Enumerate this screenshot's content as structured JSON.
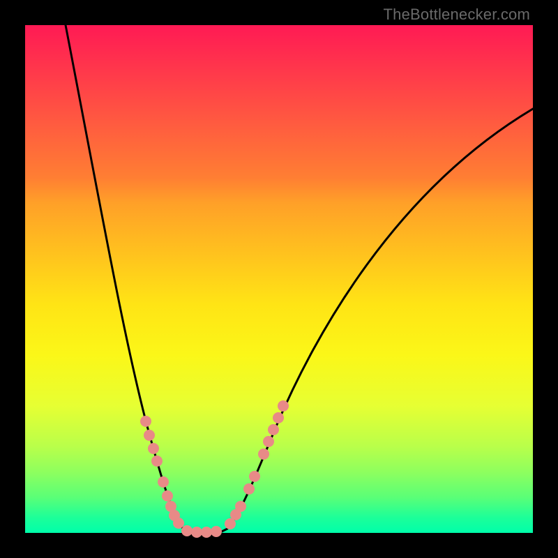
{
  "watermark": "TheBottlenecker.com",
  "colors": {
    "frame": "#000000",
    "curve": "#000000",
    "marker": "#e88a87",
    "gradient_top": "#ff1a54",
    "gradient_bottom": "#00ffaa"
  },
  "chart_data": {
    "type": "line",
    "title": "",
    "xlabel": "",
    "ylabel": "",
    "xlim": [
      0,
      100
    ],
    "ylim": [
      0,
      100
    ],
    "description": "V-shaped bottleneck curve: two monotone branches meeting at a flat minimum near x≈34. Left branch falls from (8,100) to (32,0); right branch rises from (38,0) to (100,84). Background is a vertical red→green gradient encoding curve height (high=red, low=green). Salmon dots mark sample points on both branches near the minimum.",
    "series": [
      {
        "name": "left_branch",
        "x": [
          8,
          12,
          16,
          20,
          23.5,
          26,
          28,
          29.5,
          31,
          32
        ],
        "y": [
          100,
          80,
          60,
          40,
          22,
          12,
          6,
          3,
          1,
          0
        ]
      },
      {
        "name": "right_branch",
        "x": [
          38,
          40,
          44,
          49,
          56,
          64,
          74,
          86,
          100
        ],
        "y": [
          0,
          2,
          8,
          20,
          36,
          52,
          66,
          76,
          84
        ]
      }
    ],
    "markers": [
      {
        "x": 23.5,
        "y": 22
      },
      {
        "x": 24.2,
        "y": 19
      },
      {
        "x": 25.0,
        "y": 16.5
      },
      {
        "x": 25.7,
        "y": 14
      },
      {
        "x": 27.0,
        "y": 10
      },
      {
        "x": 27.8,
        "y": 7.2
      },
      {
        "x": 28.5,
        "y": 5.2
      },
      {
        "x": 29.2,
        "y": 3.4
      },
      {
        "x": 30.0,
        "y": 1.9
      },
      {
        "x": 31.6,
        "y": 0.4
      },
      {
        "x": 33.5,
        "y": 0.1
      },
      {
        "x": 35.4,
        "y": 0.1
      },
      {
        "x": 37.3,
        "y": 0.3
      },
      {
        "x": 40.1,
        "y": 1.8
      },
      {
        "x": 41.2,
        "y": 3.6
      },
      {
        "x": 42.1,
        "y": 5.2
      },
      {
        "x": 43.8,
        "y": 8.6
      },
      {
        "x": 44.9,
        "y": 11.1
      },
      {
        "x": 46.7,
        "y": 15.5
      },
      {
        "x": 47.6,
        "y": 18.0
      },
      {
        "x": 48.6,
        "y": 20.3
      },
      {
        "x": 49.5,
        "y": 22.6
      },
      {
        "x": 50.5,
        "y": 25.0
      }
    ]
  }
}
